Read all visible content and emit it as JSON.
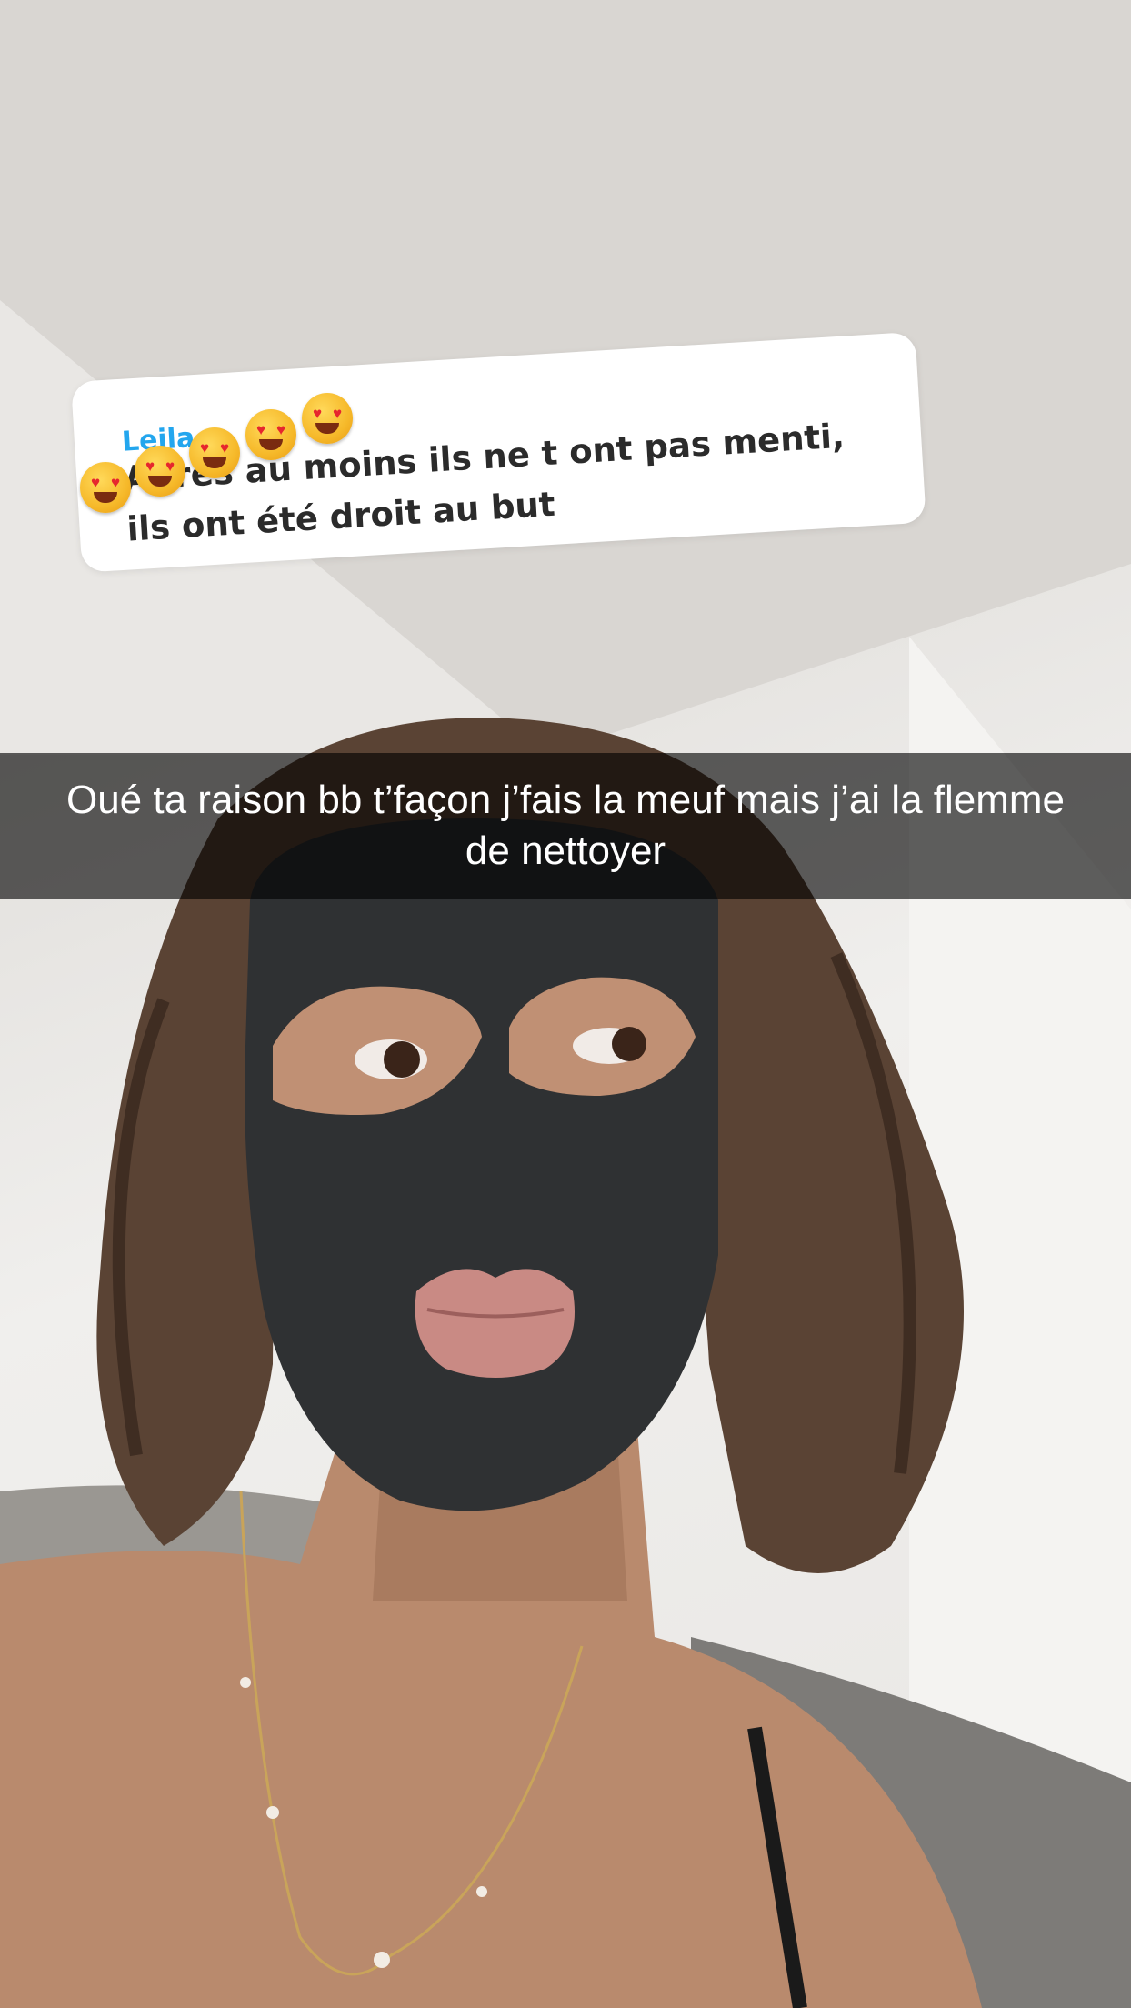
{
  "story": {
    "reply_sticker": {
      "name": "Leila",
      "text": "Après au moins ils ne t ont pas menti, ils ont été droit au but",
      "emoji_count": 5,
      "emoji_name": "heart-eyes-emoji"
    },
    "caption": "Oué ta raison bb t’façon j’fais la meuf mais j’ai la flemme de nettoyer"
  },
  "colors": {
    "name_accent": "#23a6ee",
    "caption_bar": "rgba(0,0,0,0.62)",
    "mask": "#2f3133"
  }
}
